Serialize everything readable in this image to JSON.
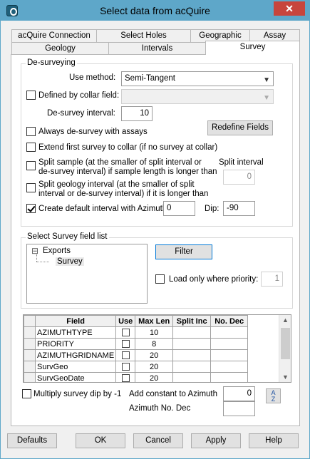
{
  "window": {
    "title": "Select data from acQuire",
    "close": "✕"
  },
  "tabs": {
    "row1": [
      "acQuire Connection",
      "Select Holes",
      "Geographic",
      "Assay"
    ],
    "row2": [
      "Geology",
      "Intervals",
      "Survey"
    ],
    "active": "Survey"
  },
  "desurveying": {
    "group_label": "De-surveying",
    "use_method_label": "Use method:",
    "use_method_value": "Semi-Tangent",
    "defined_by_collar_label": "Defined by collar field:",
    "defined_by_collar_checked": false,
    "desurvey_interval_label": "De-survey interval:",
    "desurvey_interval_value": "10",
    "always_desurvey_label": "Always de-survey with assays",
    "always_desurvey_checked": false,
    "redefine_fields_label": "Redefine Fields",
    "extend_first_label": "Extend first survey to collar (if no survey at collar)",
    "extend_first_checked": false,
    "split_sample_line1": "Split sample (at the smaller of split interval or",
    "split_sample_line2": "de-survey interval) if sample length is longer than",
    "split_sample_checked": false,
    "split_interval_label": "Split interval",
    "split_interval_value": "0",
    "split_geology_line1": "Split geology interval (at the smaller of split",
    "split_geology_line2": "interval or de-survey interval) if it  is longer than",
    "split_geology_checked": false,
    "create_default_label": "Create default interval with Azimuth",
    "create_default_checked": true,
    "azimuth_value": "0",
    "dip_label": "Dip:",
    "dip_value": "-90"
  },
  "survey_field_list": {
    "group_label": "Select Survey field list",
    "tree_root": "Exports",
    "tree_child": "Survey",
    "expander": "⊟",
    "filter_label": "Filter",
    "load_only_label": "Load only where priority:",
    "load_only_checked": false,
    "priority_value": "1"
  },
  "grid": {
    "headers": [
      "Field",
      "Use",
      "Max Len",
      "Split Inc",
      "No. Dec"
    ],
    "rows": [
      {
        "field": "AZIMUTHTYPE",
        "use": false,
        "max_len": "10",
        "split_inc": "",
        "no_dec": ""
      },
      {
        "field": "PRIORITY",
        "use": false,
        "max_len": "8",
        "split_inc": "",
        "no_dec": ""
      },
      {
        "field": "AZIMUTHGRIDNAME",
        "use": false,
        "max_len": "20",
        "split_inc": "",
        "no_dec": ""
      },
      {
        "field": "SurvGeo",
        "use": false,
        "max_len": "20",
        "split_inc": "",
        "no_dec": ""
      },
      {
        "field": "SurvGeoDate",
        "use": false,
        "max_len": "20",
        "split_inc": "",
        "no_dec": ""
      }
    ]
  },
  "bottom_options": {
    "multiply_dip_label": "Multiply survey dip by -1",
    "multiply_dip_checked": false,
    "add_constant_label": "Add constant to Azimuth",
    "add_constant_value": "0",
    "azimuth_no_dec_label": "Azimuth No. Dec",
    "azimuth_no_dec_value": "",
    "sort_icon_top": "A",
    "sort_icon_bottom": "Z"
  },
  "buttons": {
    "defaults": "Defaults",
    "ok": "OK",
    "cancel": "Cancel",
    "apply": "Apply",
    "help": "Help"
  }
}
